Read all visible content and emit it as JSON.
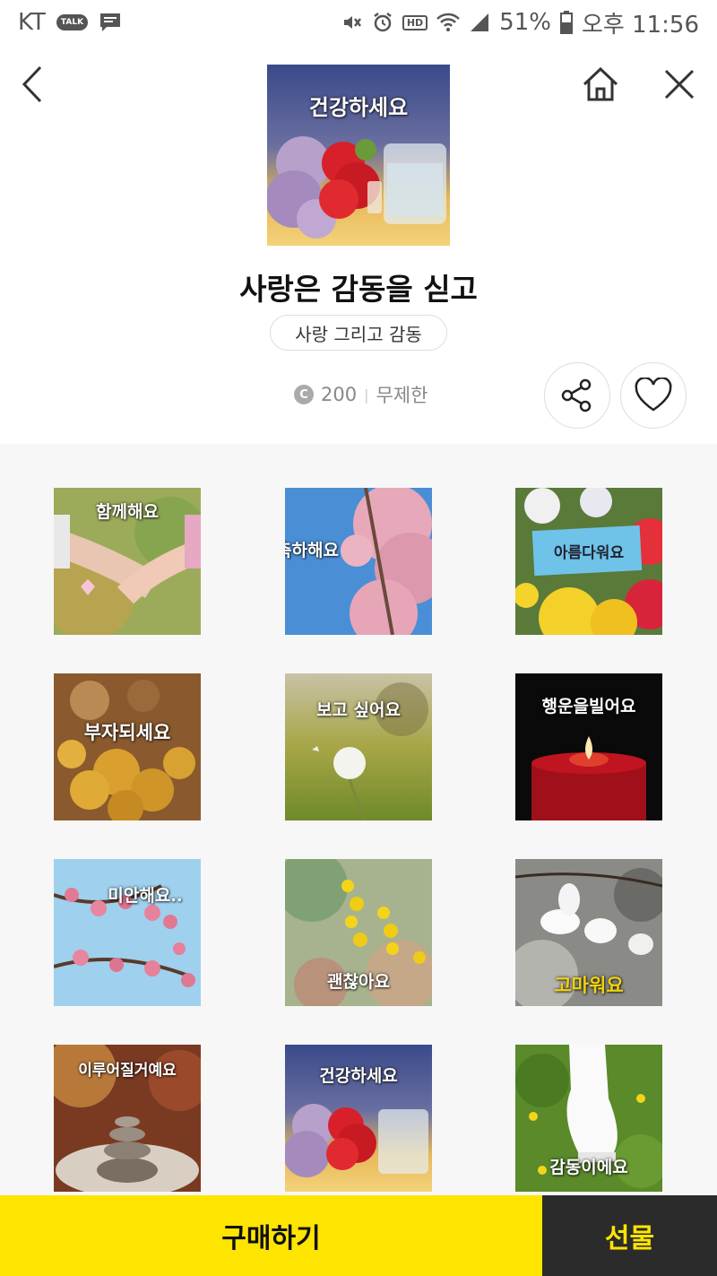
{
  "status_bar": {
    "carrier": "KT",
    "talk_badge": "TALK",
    "hd_badge": "HD",
    "battery": "51%",
    "time": "오후 11:56"
  },
  "header": {
    "title": "사랑은 감동을 싣고",
    "tag": "사랑 그리고 감동",
    "price": "200",
    "coin_symbol": "C",
    "duration": "무제한",
    "hero_caption": "건강하세요"
  },
  "stickers": [
    {
      "caption": "함께해요",
      "theme": "holding-hands"
    },
    {
      "caption": "축하해요",
      "theme": "cherry-blossom"
    },
    {
      "caption": "아름다워요",
      "theme": "flowers-sign"
    },
    {
      "caption": "부자되세요",
      "theme": "gold-coins"
    },
    {
      "caption": "보고 싶어요",
      "theme": "dandelion"
    },
    {
      "caption": "행운을빌어요",
      "theme": "red-candle"
    },
    {
      "caption": "미안해요..",
      "theme": "plum-blossom"
    },
    {
      "caption": "괜찮아요",
      "theme": "mimosa"
    },
    {
      "caption": "고마워요",
      "theme": "magnolia"
    },
    {
      "caption": "이루어질거예요",
      "theme": "stone-tower"
    },
    {
      "caption": "건강하세요",
      "theme": "flowers-glass"
    },
    {
      "caption": "감동이에요",
      "theme": "sneaker"
    }
  ],
  "bottom_bar": {
    "buy_label": "구매하기",
    "gift_label": "선물"
  },
  "colors": {
    "accent_yellow": "#fee500",
    "dark": "#2b2b2b",
    "grid_bg": "#f7f7f7"
  }
}
